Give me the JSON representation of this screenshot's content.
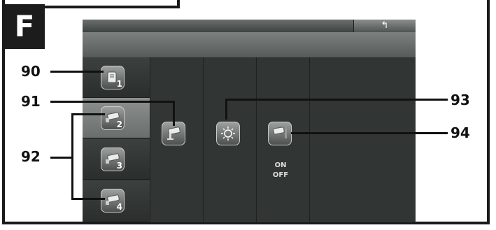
{
  "figure_label": "F",
  "screen": {
    "back_icon": "↰"
  },
  "menu_items": [
    {
      "icon": "camera-1-icon",
      "number": "1"
    },
    {
      "icon": "camera-2-icon",
      "number": "2"
    },
    {
      "icon": "camera-3-icon",
      "number": "3"
    },
    {
      "icon": "camera-4-icon",
      "number": "4"
    }
  ],
  "toggle": {
    "on_label": "ON",
    "off_label": "OFF"
  },
  "callouts": {
    "c90": "90",
    "c91": "91",
    "c92": "92",
    "c93": "93",
    "c94": "94"
  }
}
